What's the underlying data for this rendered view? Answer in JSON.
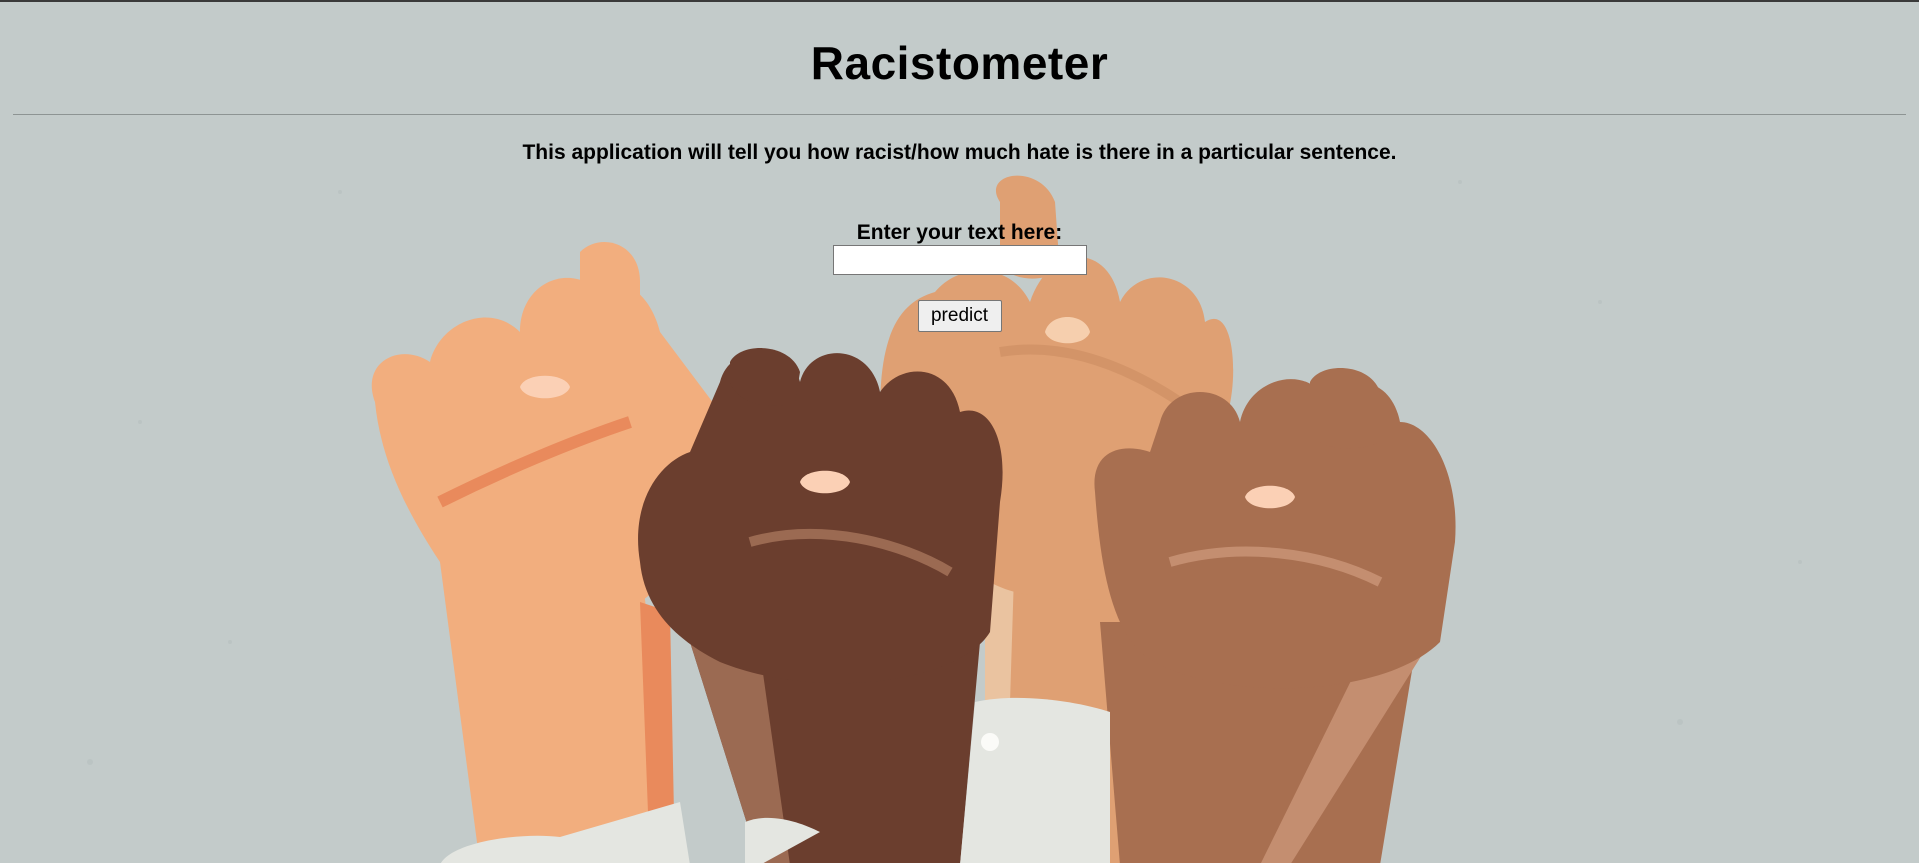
{
  "page": {
    "title": "Racistometer",
    "description": "This application will tell you how racist/how much hate is there in a particular sentence."
  },
  "form": {
    "label": "Enter your text here:",
    "input_value": "",
    "button_label": "predict"
  },
  "colors": {
    "background": "#c3cbca",
    "skin_light": "#f2ae7e",
    "skin_tan": "#dfa073",
    "skin_dark": "#6b3e2e",
    "skin_brown": "#a86f50",
    "sleeve": "#e4e6e1"
  }
}
